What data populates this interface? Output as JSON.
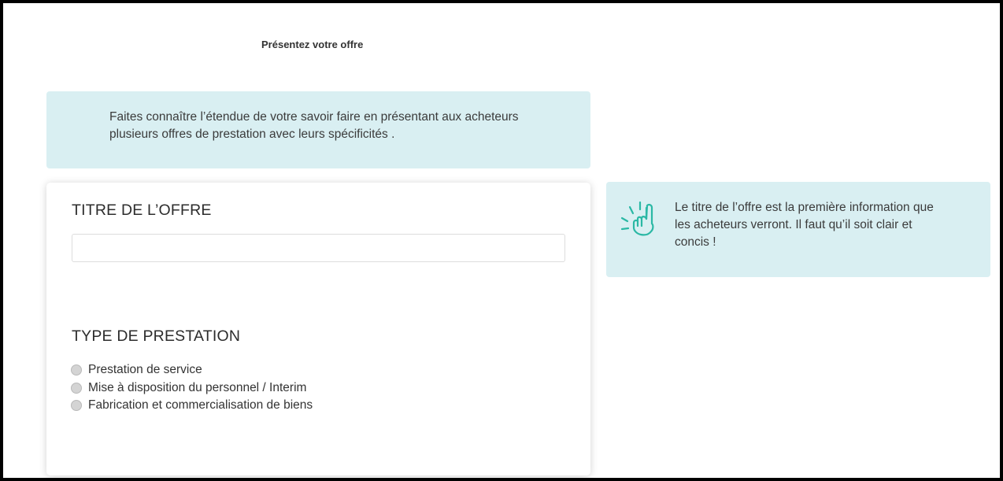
{
  "header": {
    "title": "Présentez votre offre"
  },
  "intro": {
    "text": "Faites connaître l’étendue de votre savoir faire en présentant aux acheteurs plusieurs offres de prestation avec leurs spécificités ."
  },
  "form": {
    "title_section": {
      "heading": "TITRE DE L’OFFRE",
      "input_value": ""
    },
    "type_section": {
      "heading": "TYPE DE PRESTATION",
      "options": [
        {
          "label": "Prestation de service",
          "selected": false
        },
        {
          "label": "Mise à disposition du personnel / Interim",
          "selected": false
        },
        {
          "label": "Fabrication et commercialisation de biens",
          "selected": false
        }
      ]
    }
  },
  "tip": {
    "icon": "raised-index-finger-icon",
    "text": "Le titre de l’offre est la première information que les acheteurs verront. Il faut qu’il soit clair et concis !"
  },
  "colors": {
    "info_box_bg": "#d9eff2",
    "icon_accent": "#2bb8a5",
    "radio_fill": "#d4d4d4"
  }
}
